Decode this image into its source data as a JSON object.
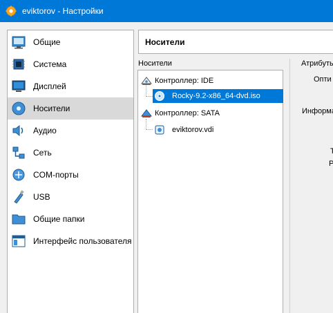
{
  "window": {
    "title": "eviktorov - Настройки"
  },
  "sidebar": {
    "items": [
      {
        "label": "Общие"
      },
      {
        "label": "Система"
      },
      {
        "label": "Дисплей"
      },
      {
        "label": "Носители",
        "selected": true
      },
      {
        "label": "Аудио"
      },
      {
        "label": "Сеть"
      },
      {
        "label": "COM-порты"
      },
      {
        "label": "USB"
      },
      {
        "label": "Общие папки"
      },
      {
        "label": "Интерфейс пользователя"
      }
    ]
  },
  "page": {
    "title": "Носители"
  },
  "media": {
    "group_label": "Носители",
    "controllers": [
      {
        "label": "Контроллер: IDE",
        "devices": [
          {
            "label": "Rocky-9.2-x86_64-dvd.iso",
            "selected": true
          }
        ]
      },
      {
        "label": "Контроллер: SATA",
        "devices": [
          {
            "label": "eviktorov.vdi"
          }
        ]
      }
    ]
  },
  "attributes": {
    "group_label": "Атрибуты",
    "optical_label": "Опти",
    "info_label": "Информац",
    "row1": "Т",
    "row2": "Р"
  },
  "colors": {
    "titlebar": "#0078d7",
    "selection": "#0078d7",
    "sidebar_selected": "#d9d9d9"
  }
}
